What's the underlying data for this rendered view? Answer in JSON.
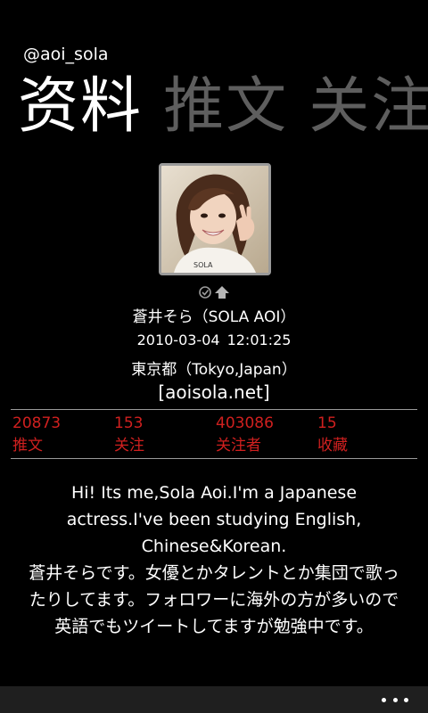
{
  "profile": {
    "handle": "@aoi_sola",
    "display_name": "蒼井そら（SOLA AOI）",
    "created_date": "2010-03-04",
    "created_time": "12:01:25",
    "location": "東京都（Tokyo,Japan）",
    "website": "[aoisola.net]",
    "bio_en": "Hi! Its me,Sola Aoi.I'm a Japanese actress.I've been studying English, Chinese&Korean.",
    "bio_jp": "蒼井そらです。女優とかタレントとか集団で歌ったりしてます。フォロワーに海外の方が多いので英語でもツイートしてますが勉強中です。",
    "status_icons": [
      "verified-check-icon",
      "up-arrow-icon"
    ]
  },
  "pivot": {
    "items": [
      {
        "label": "资料",
        "active": true
      },
      {
        "label": "推文",
        "active": false
      },
      {
        "label": "关注",
        "active": false
      }
    ]
  },
  "stats": [
    {
      "value": "20873",
      "label": "推文"
    },
    {
      "value": "153",
      "label": "关注"
    },
    {
      "value": "403086",
      "label": "关注者"
    },
    {
      "value": "15",
      "label": "收藏"
    }
  ],
  "appbar": {
    "more_icon": "ellipsis-icon"
  },
  "colors": {
    "background": "#000000",
    "text": "#ffffff",
    "inactive_pivot": "#5e5e5e",
    "stat_accent": "#d0201f",
    "appbar": "#1f1f1f",
    "divider": "#9a9a9a"
  }
}
